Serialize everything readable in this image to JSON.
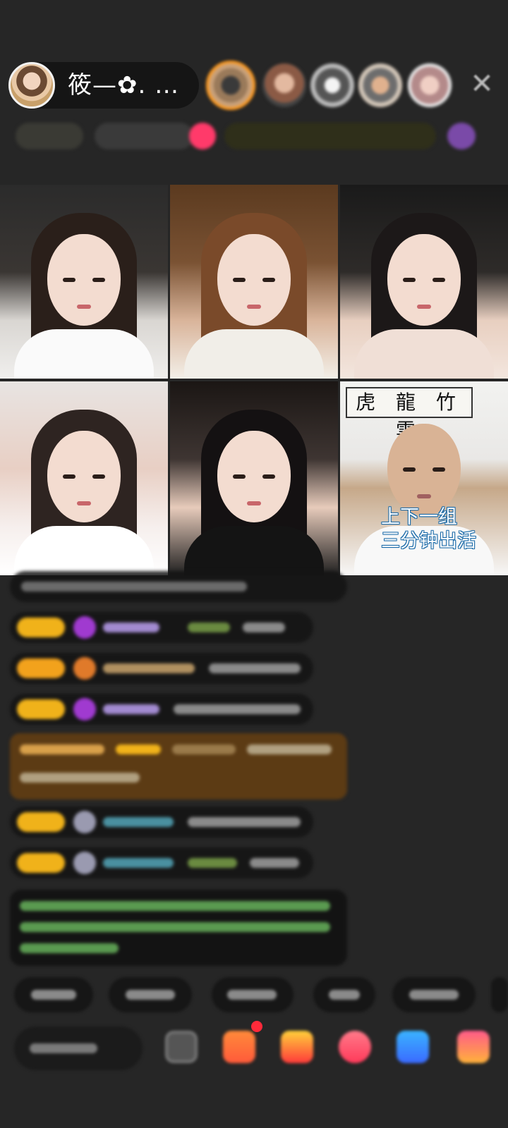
{
  "host": {
    "name": "筱—✿. …"
  },
  "close_icon_glyph": "✕",
  "video_grid": {
    "tiles": [
      {
        "id": 1,
        "calligraphy": ""
      },
      {
        "id": 2,
        "calligraphy": ""
      },
      {
        "id": 3,
        "calligraphy": ""
      },
      {
        "id": 4,
        "calligraphy": ""
      },
      {
        "id": 5,
        "calligraphy": ""
      },
      {
        "id": 6,
        "calligraphy": "虎 龍 竹 雲"
      }
    ],
    "caption_line1": "上下一组",
    "caption_line2": "三分钟出活"
  },
  "colors": {
    "background": "#262626",
    "badge_gold": "#f0b21a",
    "highlight_row": "#5c3b14",
    "accent_orange": "#ff9a1f",
    "caption_outline": "#1a6aa8"
  },
  "icons": [
    "close-icon",
    "more-icon",
    "gift-icon",
    "shop-icon",
    "heart-icon",
    "share-icon",
    "game-icon"
  ]
}
